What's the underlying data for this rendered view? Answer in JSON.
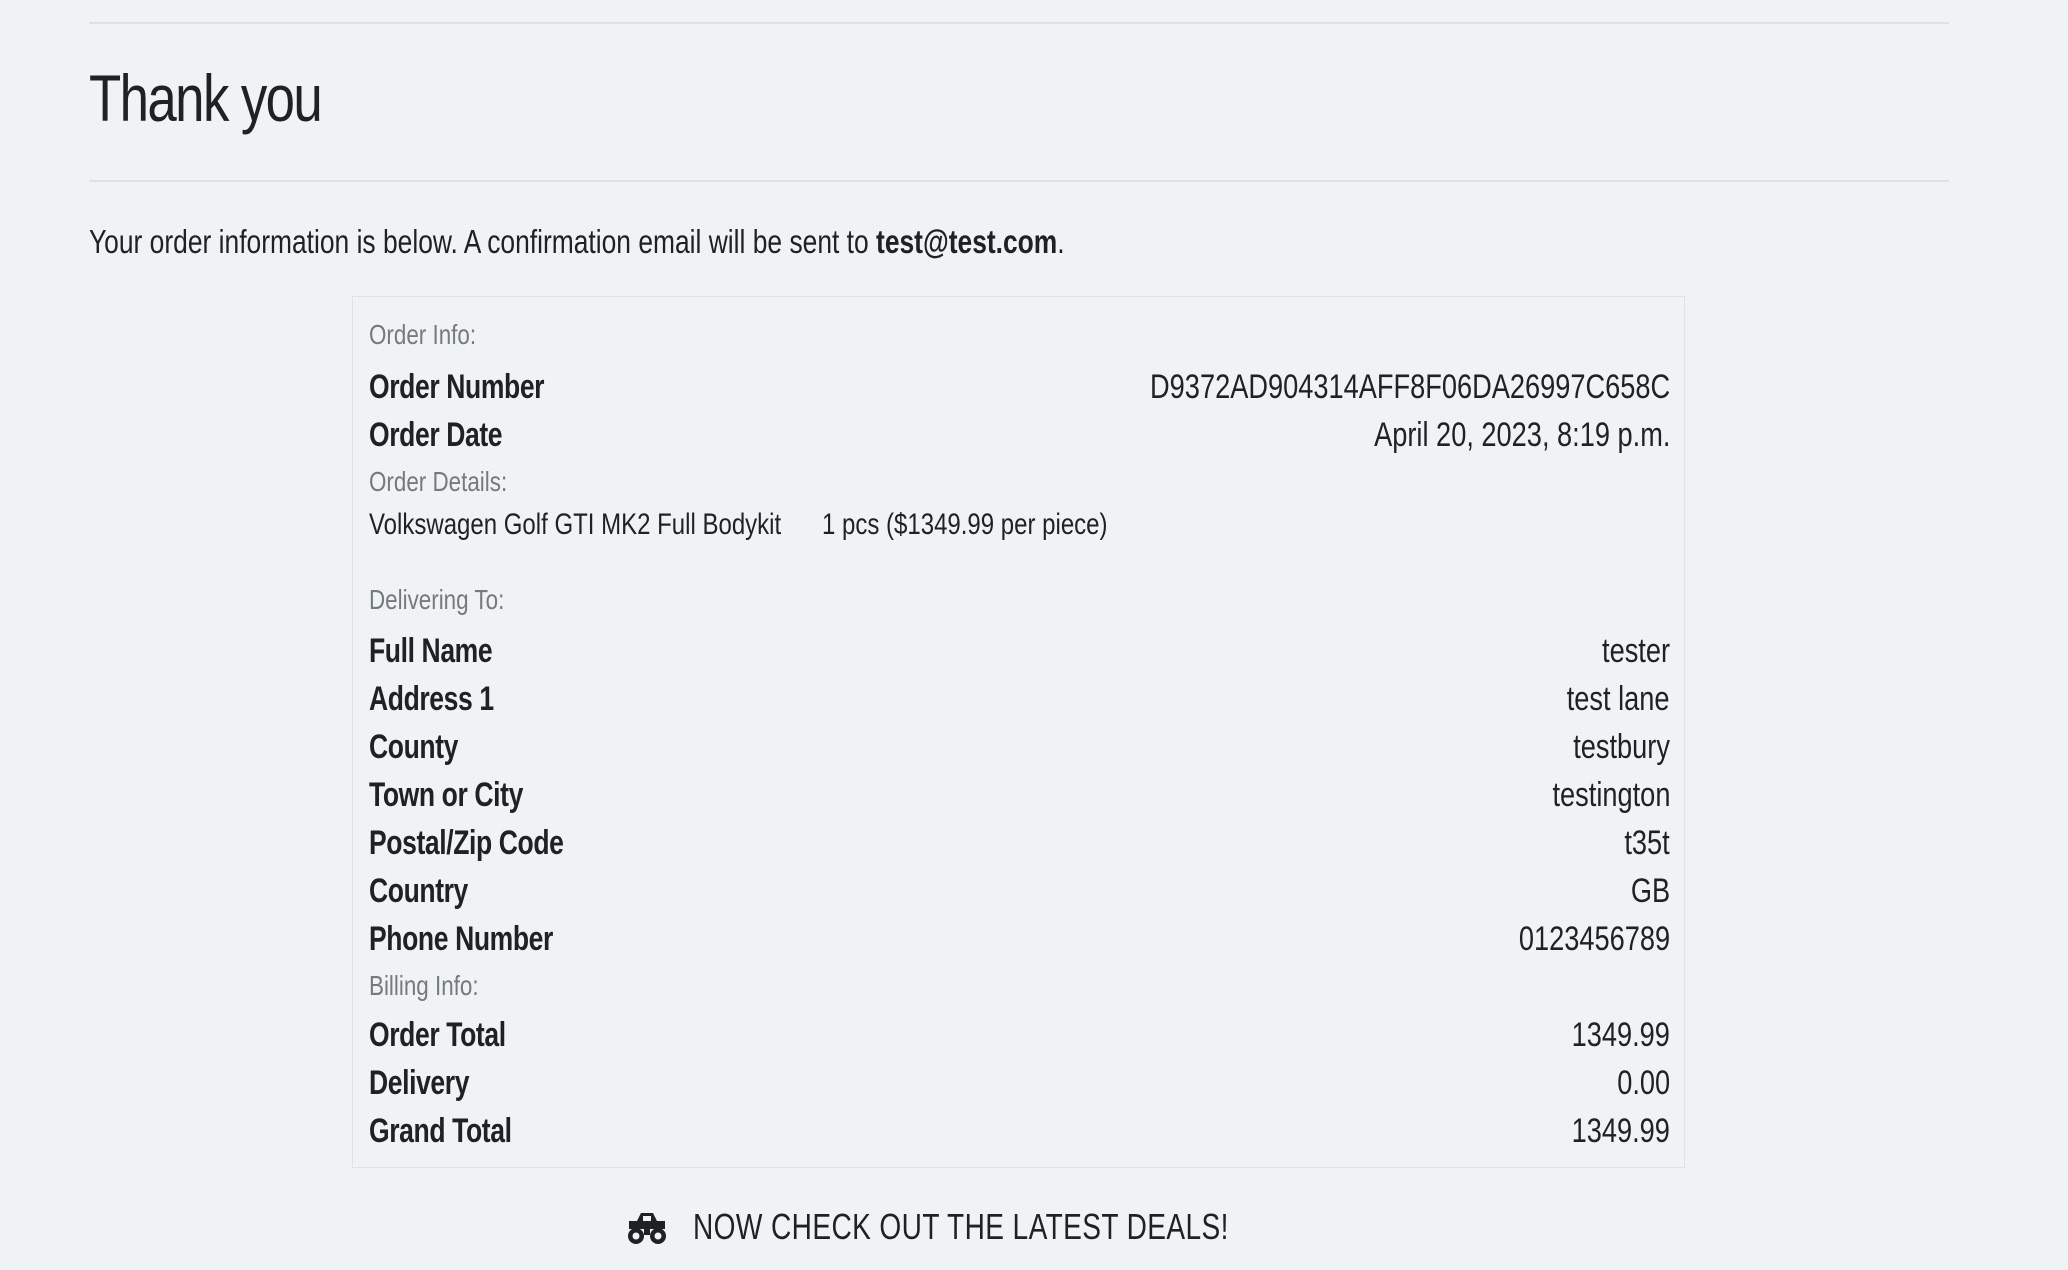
{
  "header": {
    "title": "Thank you"
  },
  "intro": {
    "text_before": "Your order information is below. A confirmation email will be sent to ",
    "email": "test@test.com",
    "text_after": "."
  },
  "order_info": {
    "section_label": "Order Info:",
    "rows": [
      {
        "key": "Order Number",
        "value": "D9372AD904314AFF8F06DA26997C658C"
      },
      {
        "key": "Order Date",
        "value": "April 20, 2023, 8:19 p.m."
      }
    ]
  },
  "order_details": {
    "section_label": "Order Details:",
    "items": [
      {
        "name": "Volkswagen Golf GTI MK2 Full Bodykit",
        "quantity": "1 pcs ($1349.99 per piece)"
      }
    ]
  },
  "delivering_to": {
    "section_label": "Delivering To:",
    "rows": [
      {
        "key": "Full Name",
        "value": "tester"
      },
      {
        "key": "Address 1",
        "value": "test lane"
      },
      {
        "key": "County",
        "value": "testbury"
      },
      {
        "key": "Town or City",
        "value": "testington"
      },
      {
        "key": "Postal/Zip Code",
        "value": "t35t"
      },
      {
        "key": "Country",
        "value": "GB"
      },
      {
        "key": "Phone Number",
        "value": "0123456789"
      }
    ]
  },
  "billing_info": {
    "section_label": "Billing Info:",
    "rows": [
      {
        "key": "Order Total",
        "value": "1349.99"
      },
      {
        "key": "Delivery",
        "value": "0.00"
      },
      {
        "key": "Grand Total",
        "value": "1349.99"
      }
    ]
  },
  "deals_link": {
    "icon": "monster-truck-icon",
    "label": "NOW CHECK OUT THE LATEST DEALS!"
  }
}
